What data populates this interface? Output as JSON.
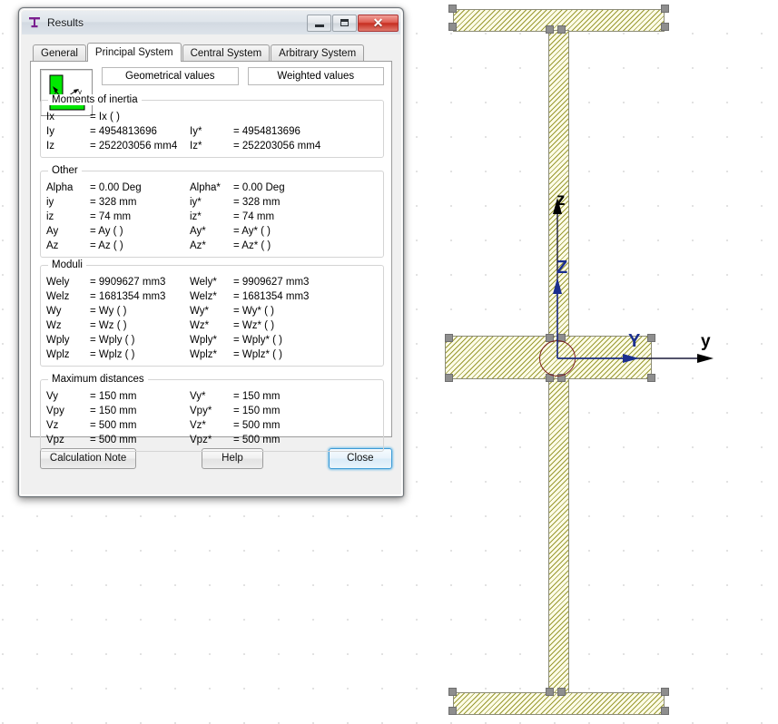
{
  "window": {
    "title": "Results",
    "icon": "i-beam-section-icon",
    "controls": {
      "minimize": "minimize-icon",
      "maximize": "maximize-icon",
      "close": "✕"
    }
  },
  "tabs": [
    {
      "label": "General",
      "active": false
    },
    {
      "label": "Principal System",
      "active": true
    },
    {
      "label": "Central System",
      "active": false
    },
    {
      "label": "Arbitrary System",
      "active": false
    }
  ],
  "column_headers": {
    "geometrical": "Geometrical values",
    "weighted": "Weighted values"
  },
  "groups": [
    {
      "legend": "Moments of inertia",
      "rows": [
        {
          "sym": "Ix",
          "val": "= Ix ( )",
          "sym2": "",
          "val2": ""
        },
        {
          "sym": "Iy",
          "val": "= 4954813696",
          "sym2": "Iy*",
          "val2": "= 4954813696"
        },
        {
          "sym": "Iz",
          "val": "= 252203056 mm4",
          "sym2": "Iz*",
          "val2": "= 252203056 mm4"
        }
      ]
    },
    {
      "legend": "Other",
      "rows": [
        {
          "sym": "Alpha",
          "val": "= 0.00 Deg",
          "sym2": "Alpha*",
          "val2": "= 0.00 Deg"
        },
        {
          "sym": "iy",
          "val": "= 328 mm",
          "sym2": "iy*",
          "val2": "= 328 mm"
        },
        {
          "sym": "iz",
          "val": "= 74 mm",
          "sym2": "iz*",
          "val2": "= 74 mm"
        },
        {
          "sym": "Ay",
          "val": "= Ay ( )",
          "sym2": "Ay*",
          "val2": "= Ay* ( )"
        },
        {
          "sym": "Az",
          "val": "= Az ( )",
          "sym2": "Az*",
          "val2": "= Az* ( )"
        }
      ]
    },
    {
      "legend": "Moduli",
      "rows": [
        {
          "sym": "Wely",
          "val": "= 9909627 mm3",
          "sym2": "Wely*",
          "val2": "= 9909627 mm3"
        },
        {
          "sym": "Welz",
          "val": "= 1681354 mm3",
          "sym2": "Welz*",
          "val2": "= 1681354 mm3"
        },
        {
          "sym": "Wy",
          "val": "= Wy ( )",
          "sym2": "Wy*",
          "val2": "= Wy* ( )"
        },
        {
          "sym": "Wz",
          "val": "= Wz ( )",
          "sym2": "Wz*",
          "val2": "= Wz* ( )"
        },
        {
          "sym": "Wply",
          "val": "= Wply ( )",
          "sym2": "Wply*",
          "val2": "= Wply* ( )"
        },
        {
          "sym": "Wplz",
          "val": "= Wplz ( )",
          "sym2": "Wplz*",
          "val2": "= Wplz* ( )"
        }
      ]
    },
    {
      "legend": "Maximum distances",
      "rows": [
        {
          "sym": "Vy",
          "val": "= 150 mm",
          "sym2": "Vy*",
          "val2": "= 150 mm"
        },
        {
          "sym": "Vpy",
          "val": "= 150 mm",
          "sym2": "Vpy*",
          "val2": "= 150 mm"
        },
        {
          "sym": "Vz",
          "val": "= 500 mm",
          "sym2": "Vz*",
          "val2": "= 500 mm"
        },
        {
          "sym": "Vpz",
          "val": "= 500 mm",
          "sym2": "Vpz*",
          "val2": "= 500 mm"
        }
      ]
    }
  ],
  "buttons": {
    "calculation_note": "Calculation Note",
    "help": "Help",
    "close": "Close"
  },
  "drawing": {
    "axis_labels": {
      "global_z": "z",
      "global_y": "y",
      "principal_z": "Z",
      "principal_y": "Y"
    },
    "colors": {
      "hatch": "#9a9a33",
      "fill": "#fdfce8",
      "outline": "#8c8c78",
      "handle": "#8e8e8e",
      "principal_axis": "#1b2f8f",
      "global_axis": "#000000",
      "centroid": "#7a1f1f"
    },
    "shape": "i-beam-cross-section"
  }
}
